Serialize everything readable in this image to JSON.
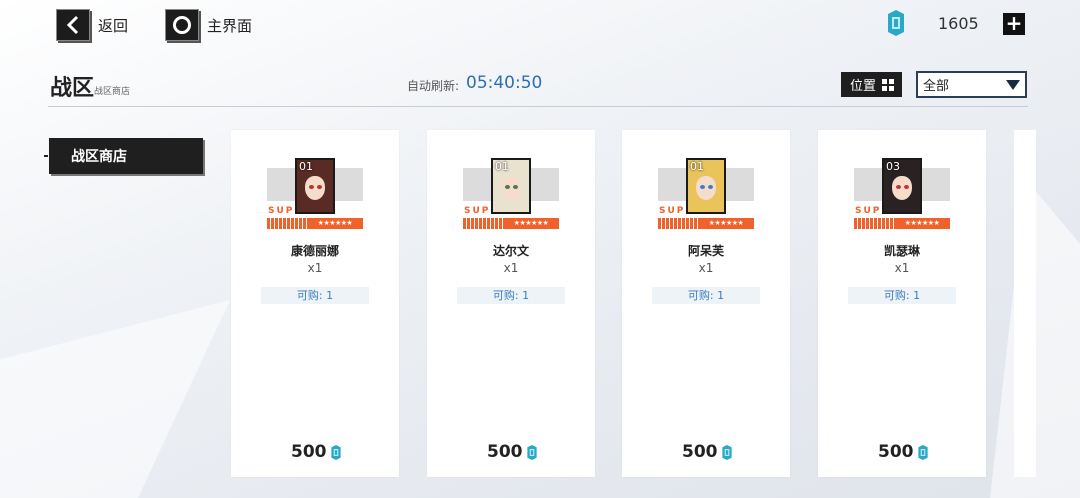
{
  "topbar": {
    "back_label": "返回",
    "home_label": "主界面",
    "currency_value": "1605",
    "plus_label": "+"
  },
  "header": {
    "title": "战区",
    "subtitle": "战区商店",
    "refresh_label": "自动刷新:",
    "refresh_time": "05:40:50",
    "sort_label": "位置",
    "filter_value": "全部"
  },
  "sidebar": {
    "tabs": [
      {
        "label": "战区商店"
      }
    ]
  },
  "items": [
    {
      "num": "01",
      "supply": "SUPPLY",
      "stars": "★★★★★★",
      "name": "康德丽娜",
      "qty": "x1",
      "limit": "可购: 1",
      "price": "500",
      "hair": "#5a2a24",
      "eye": "#c0302a"
    },
    {
      "num": "01",
      "supply": "SUPPLY",
      "stars": "★★★★★★",
      "name": "达尔文",
      "qty": "x1",
      "limit": "可购: 1",
      "price": "500",
      "hair": "#e9e2cf",
      "eye": "#4a7a55"
    },
    {
      "num": "01",
      "supply": "SUPPLY",
      "stars": "★★★★★★",
      "name": "阿呆芙",
      "qty": "x1",
      "limit": "可购: 1",
      "price": "500",
      "hair": "#e8c45a",
      "eye": "#3b7fc8"
    },
    {
      "num": "03",
      "supply": "SUPPLY",
      "stars": "★★★★★★",
      "name": "凯瑟琳",
      "qty": "x1",
      "limit": "可购: 1",
      "price": "500",
      "hair": "#2a2222",
      "eye": "#b83a3a"
    }
  ],
  "colors": {
    "accent_blue": "#2f6fb0",
    "supply_orange": "#f0622a",
    "currency_cyan": "#29a9c6"
  }
}
